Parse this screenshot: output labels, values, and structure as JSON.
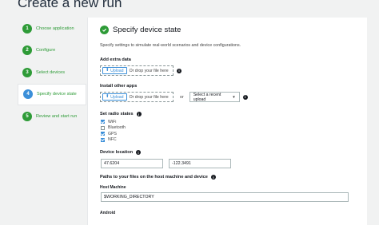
{
  "page_title": "Create a new run",
  "steps": [
    {
      "number": "1",
      "label": "Choose application",
      "state": "done"
    },
    {
      "number": "2",
      "label": "Configure",
      "state": "done"
    },
    {
      "number": "3",
      "label": "Select devices",
      "state": "done"
    },
    {
      "number": "4",
      "label": "Specify device state",
      "state": "active"
    },
    {
      "number": "5",
      "label": "Review and start run",
      "state": "done"
    }
  ],
  "panel": {
    "title": "Specify device state",
    "description": "Specify settings to simulate real-world scenarios and device configurations.",
    "extra_data": {
      "label": "Add extra data",
      "upload_label": "Upload",
      "drop_text": "Or drop your file here"
    },
    "other_apps": {
      "label": "Install other apps",
      "upload_label": "Upload",
      "drop_text": "Or drop your file here",
      "or_text": "or",
      "select_placeholder": "Select a recent upload"
    },
    "radio_states": {
      "label": "Set radio states",
      "items": [
        {
          "label": "WiFi",
          "checked": true
        },
        {
          "label": "Bluetooth",
          "checked": false
        },
        {
          "label": "GPS",
          "checked": true
        },
        {
          "label": "NFC",
          "checked": true
        }
      ]
    },
    "device_location": {
      "label": "Device location",
      "latitude": "47.6204",
      "longitude": "-122.3491"
    },
    "paths": {
      "label": "Paths to your files on the host machine and device",
      "host_label": "Host Machine",
      "host_value": "$WORKING_DIRECTORY",
      "android_label": "Android"
    }
  },
  "colors": {
    "accent_green": "#2e9b37",
    "accent_blue": "#3b8fd9"
  }
}
